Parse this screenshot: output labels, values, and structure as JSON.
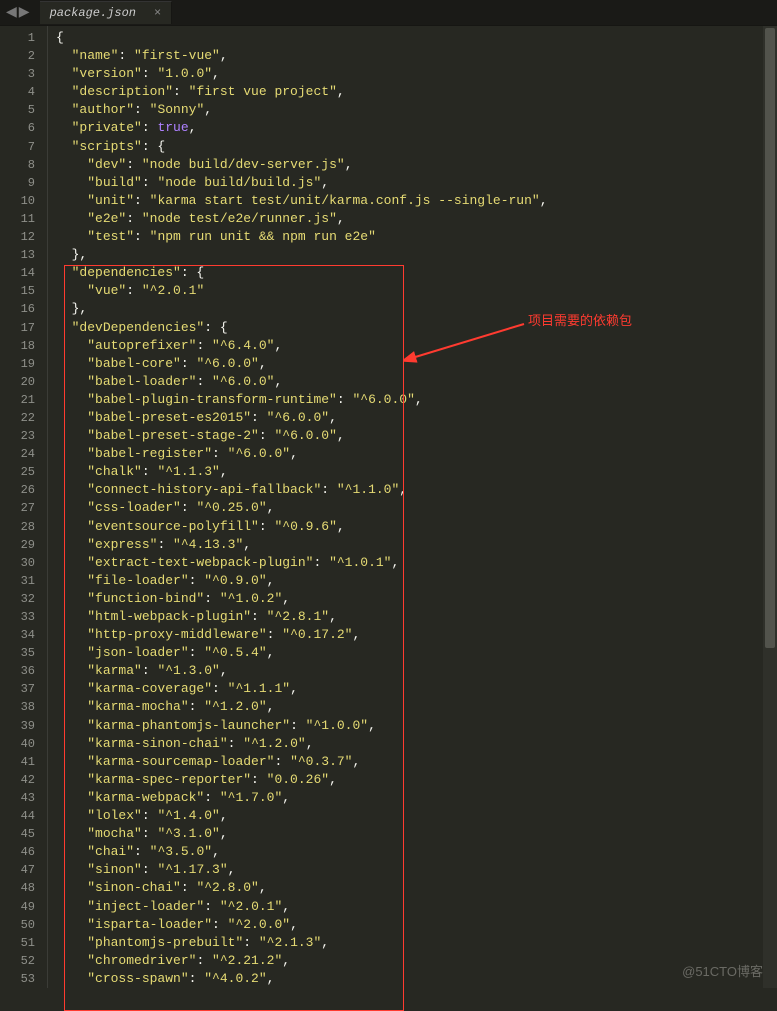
{
  "tab": {
    "title": "package.json",
    "close": "×"
  },
  "nav": {
    "left": "◀",
    "right": "▶"
  },
  "annotation": {
    "label": "项目需要的依赖包"
  },
  "watermark": "@51CTO博客",
  "code_lines": [
    [
      [
        "p",
        "{"
      ]
    ],
    [
      [
        "p",
        "  "
      ],
      [
        "s",
        "\"name\""
      ],
      [
        "p",
        ": "
      ],
      [
        "s",
        "\"first-vue\""
      ],
      [
        "p",
        ","
      ]
    ],
    [
      [
        "p",
        "  "
      ],
      [
        "s",
        "\"version\""
      ],
      [
        "p",
        ": "
      ],
      [
        "s",
        "\"1.0.0\""
      ],
      [
        "p",
        ","
      ]
    ],
    [
      [
        "p",
        "  "
      ],
      [
        "s",
        "\"description\""
      ],
      [
        "p",
        ": "
      ],
      [
        "s",
        "\"first vue project\""
      ],
      [
        "p",
        ","
      ]
    ],
    [
      [
        "p",
        "  "
      ],
      [
        "s",
        "\"author\""
      ],
      [
        "p",
        ": "
      ],
      [
        "s",
        "\"Sonny\""
      ],
      [
        "p",
        ","
      ]
    ],
    [
      [
        "p",
        "  "
      ],
      [
        "s",
        "\"private\""
      ],
      [
        "p",
        ": "
      ],
      [
        "c",
        "true"
      ],
      [
        "p",
        ","
      ]
    ],
    [
      [
        "p",
        "  "
      ],
      [
        "s",
        "\"scripts\""
      ],
      [
        "p",
        ": {"
      ]
    ],
    [
      [
        "p",
        "    "
      ],
      [
        "s",
        "\"dev\""
      ],
      [
        "p",
        ": "
      ],
      [
        "s",
        "\"node build/dev-server.js\""
      ],
      [
        "p",
        ","
      ]
    ],
    [
      [
        "p",
        "    "
      ],
      [
        "s",
        "\"build\""
      ],
      [
        "p",
        ": "
      ],
      [
        "s",
        "\"node build/build.js\""
      ],
      [
        "p",
        ","
      ]
    ],
    [
      [
        "p",
        "    "
      ],
      [
        "s",
        "\"unit\""
      ],
      [
        "p",
        ": "
      ],
      [
        "s",
        "\"karma start test/unit/karma.conf.js --single-run\""
      ],
      [
        "p",
        ","
      ]
    ],
    [
      [
        "p",
        "    "
      ],
      [
        "s",
        "\"e2e\""
      ],
      [
        "p",
        ": "
      ],
      [
        "s",
        "\"node test/e2e/runner.js\""
      ],
      [
        "p",
        ","
      ]
    ],
    [
      [
        "p",
        "    "
      ],
      [
        "s",
        "\"test\""
      ],
      [
        "p",
        ": "
      ],
      [
        "s",
        "\"npm run unit && npm run e2e\""
      ]
    ],
    [
      [
        "p",
        "  },"
      ]
    ],
    [
      [
        "p",
        "  "
      ],
      [
        "s",
        "\"dependencies\""
      ],
      [
        "p",
        ": {"
      ]
    ],
    [
      [
        "p",
        "    "
      ],
      [
        "s",
        "\"vue\""
      ],
      [
        "p",
        ": "
      ],
      [
        "s",
        "\"^2.0.1\""
      ]
    ],
    [
      [
        "p",
        "  },"
      ]
    ],
    [
      [
        "p",
        "  "
      ],
      [
        "s",
        "\"devDependencies\""
      ],
      [
        "p",
        ": {"
      ]
    ],
    [
      [
        "p",
        "    "
      ],
      [
        "s",
        "\"autoprefixer\""
      ],
      [
        "p",
        ": "
      ],
      [
        "s",
        "\"^6.4.0\""
      ],
      [
        "p",
        ","
      ]
    ],
    [
      [
        "p",
        "    "
      ],
      [
        "s",
        "\"babel-core\""
      ],
      [
        "p",
        ": "
      ],
      [
        "s",
        "\"^6.0.0\""
      ],
      [
        "p",
        ","
      ]
    ],
    [
      [
        "p",
        "    "
      ],
      [
        "s",
        "\"babel-loader\""
      ],
      [
        "p",
        ": "
      ],
      [
        "s",
        "\"^6.0.0\""
      ],
      [
        "p",
        ","
      ]
    ],
    [
      [
        "p",
        "    "
      ],
      [
        "s",
        "\"babel-plugin-transform-runtime\""
      ],
      [
        "p",
        ": "
      ],
      [
        "s",
        "\"^6.0.0\""
      ],
      [
        "p",
        ","
      ]
    ],
    [
      [
        "p",
        "    "
      ],
      [
        "s",
        "\"babel-preset-es2015\""
      ],
      [
        "p",
        ": "
      ],
      [
        "s",
        "\"^6.0.0\""
      ],
      [
        "p",
        ","
      ]
    ],
    [
      [
        "p",
        "    "
      ],
      [
        "s",
        "\"babel-preset-stage-2\""
      ],
      [
        "p",
        ": "
      ],
      [
        "s",
        "\"^6.0.0\""
      ],
      [
        "p",
        ","
      ]
    ],
    [
      [
        "p",
        "    "
      ],
      [
        "s",
        "\"babel-register\""
      ],
      [
        "p",
        ": "
      ],
      [
        "s",
        "\"^6.0.0\""
      ],
      [
        "p",
        ","
      ]
    ],
    [
      [
        "p",
        "    "
      ],
      [
        "s",
        "\"chalk\""
      ],
      [
        "p",
        ": "
      ],
      [
        "s",
        "\"^1.1.3\""
      ],
      [
        "p",
        ","
      ]
    ],
    [
      [
        "p",
        "    "
      ],
      [
        "s",
        "\"connect-history-api-fallback\""
      ],
      [
        "p",
        ": "
      ],
      [
        "s",
        "\"^1.1.0\""
      ],
      [
        "p",
        ","
      ]
    ],
    [
      [
        "p",
        "    "
      ],
      [
        "s",
        "\"css-loader\""
      ],
      [
        "p",
        ": "
      ],
      [
        "s",
        "\"^0.25.0\""
      ],
      [
        "p",
        ","
      ]
    ],
    [
      [
        "p",
        "    "
      ],
      [
        "s",
        "\"eventsource-polyfill\""
      ],
      [
        "p",
        ": "
      ],
      [
        "s",
        "\"^0.9.6\""
      ],
      [
        "p",
        ","
      ]
    ],
    [
      [
        "p",
        "    "
      ],
      [
        "s",
        "\"express\""
      ],
      [
        "p",
        ": "
      ],
      [
        "s",
        "\"^4.13.3\""
      ],
      [
        "p",
        ","
      ]
    ],
    [
      [
        "p",
        "    "
      ],
      [
        "s",
        "\"extract-text-webpack-plugin\""
      ],
      [
        "p",
        ": "
      ],
      [
        "s",
        "\"^1.0.1\""
      ],
      [
        "p",
        ","
      ]
    ],
    [
      [
        "p",
        "    "
      ],
      [
        "s",
        "\"file-loader\""
      ],
      [
        "p",
        ": "
      ],
      [
        "s",
        "\"^0.9.0\""
      ],
      [
        "p",
        ","
      ]
    ],
    [
      [
        "p",
        "    "
      ],
      [
        "s",
        "\"function-bind\""
      ],
      [
        "p",
        ": "
      ],
      [
        "s",
        "\"^1.0.2\""
      ],
      [
        "p",
        ","
      ]
    ],
    [
      [
        "p",
        "    "
      ],
      [
        "s",
        "\"html-webpack-plugin\""
      ],
      [
        "p",
        ": "
      ],
      [
        "s",
        "\"^2.8.1\""
      ],
      [
        "p",
        ","
      ]
    ],
    [
      [
        "p",
        "    "
      ],
      [
        "s",
        "\"http-proxy-middleware\""
      ],
      [
        "p",
        ": "
      ],
      [
        "s",
        "\"^0.17.2\""
      ],
      [
        "p",
        ","
      ]
    ],
    [
      [
        "p",
        "    "
      ],
      [
        "s",
        "\"json-loader\""
      ],
      [
        "p",
        ": "
      ],
      [
        "s",
        "\"^0.5.4\""
      ],
      [
        "p",
        ","
      ]
    ],
    [
      [
        "p",
        "    "
      ],
      [
        "s",
        "\"karma\""
      ],
      [
        "p",
        ": "
      ],
      [
        "s",
        "\"^1.3.0\""
      ],
      [
        "p",
        ","
      ]
    ],
    [
      [
        "p",
        "    "
      ],
      [
        "s",
        "\"karma-coverage\""
      ],
      [
        "p",
        ": "
      ],
      [
        "s",
        "\"^1.1.1\""
      ],
      [
        "p",
        ","
      ]
    ],
    [
      [
        "p",
        "    "
      ],
      [
        "s",
        "\"karma-mocha\""
      ],
      [
        "p",
        ": "
      ],
      [
        "s",
        "\"^1.2.0\""
      ],
      [
        "p",
        ","
      ]
    ],
    [
      [
        "p",
        "    "
      ],
      [
        "s",
        "\"karma-phantomjs-launcher\""
      ],
      [
        "p",
        ": "
      ],
      [
        "s",
        "\"^1.0.0\""
      ],
      [
        "p",
        ","
      ]
    ],
    [
      [
        "p",
        "    "
      ],
      [
        "s",
        "\"karma-sinon-chai\""
      ],
      [
        "p",
        ": "
      ],
      [
        "s",
        "\"^1.2.0\""
      ],
      [
        "p",
        ","
      ]
    ],
    [
      [
        "p",
        "    "
      ],
      [
        "s",
        "\"karma-sourcemap-loader\""
      ],
      [
        "p",
        ": "
      ],
      [
        "s",
        "\"^0.3.7\""
      ],
      [
        "p",
        ","
      ]
    ],
    [
      [
        "p",
        "    "
      ],
      [
        "s",
        "\"karma-spec-reporter\""
      ],
      [
        "p",
        ": "
      ],
      [
        "s",
        "\"0.0.26\""
      ],
      [
        "p",
        ","
      ]
    ],
    [
      [
        "p",
        "    "
      ],
      [
        "s",
        "\"karma-webpack\""
      ],
      [
        "p",
        ": "
      ],
      [
        "s",
        "\"^1.7.0\""
      ],
      [
        "p",
        ","
      ]
    ],
    [
      [
        "p",
        "    "
      ],
      [
        "s",
        "\"lolex\""
      ],
      [
        "p",
        ": "
      ],
      [
        "s",
        "\"^1.4.0\""
      ],
      [
        "p",
        ","
      ]
    ],
    [
      [
        "p",
        "    "
      ],
      [
        "s",
        "\"mocha\""
      ],
      [
        "p",
        ": "
      ],
      [
        "s",
        "\"^3.1.0\""
      ],
      [
        "p",
        ","
      ]
    ],
    [
      [
        "p",
        "    "
      ],
      [
        "s",
        "\"chai\""
      ],
      [
        "p",
        ": "
      ],
      [
        "s",
        "\"^3.5.0\""
      ],
      [
        "p",
        ","
      ]
    ],
    [
      [
        "p",
        "    "
      ],
      [
        "s",
        "\"sinon\""
      ],
      [
        "p",
        ": "
      ],
      [
        "s",
        "\"^1.17.3\""
      ],
      [
        "p",
        ","
      ]
    ],
    [
      [
        "p",
        "    "
      ],
      [
        "s",
        "\"sinon-chai\""
      ],
      [
        "p",
        ": "
      ],
      [
        "s",
        "\"^2.8.0\""
      ],
      [
        "p",
        ","
      ]
    ],
    [
      [
        "p",
        "    "
      ],
      [
        "s",
        "\"inject-loader\""
      ],
      [
        "p",
        ": "
      ],
      [
        "s",
        "\"^2.0.1\""
      ],
      [
        "p",
        ","
      ]
    ],
    [
      [
        "p",
        "    "
      ],
      [
        "s",
        "\"isparta-loader\""
      ],
      [
        "p",
        ": "
      ],
      [
        "s",
        "\"^2.0.0\""
      ],
      [
        "p",
        ","
      ]
    ],
    [
      [
        "p",
        "    "
      ],
      [
        "s",
        "\"phantomjs-prebuilt\""
      ],
      [
        "p",
        ": "
      ],
      [
        "s",
        "\"^2.1.3\""
      ],
      [
        "p",
        ","
      ]
    ],
    [
      [
        "p",
        "    "
      ],
      [
        "s",
        "\"chromedriver\""
      ],
      [
        "p",
        ": "
      ],
      [
        "s",
        "\"^2.21.2\""
      ],
      [
        "p",
        ","
      ]
    ],
    [
      [
        "p",
        "    "
      ],
      [
        "s",
        "\"cross-spawn\""
      ],
      [
        "p",
        ": "
      ],
      [
        "s",
        "\"^4.0.2\""
      ],
      [
        "p",
        ","
      ]
    ]
  ]
}
